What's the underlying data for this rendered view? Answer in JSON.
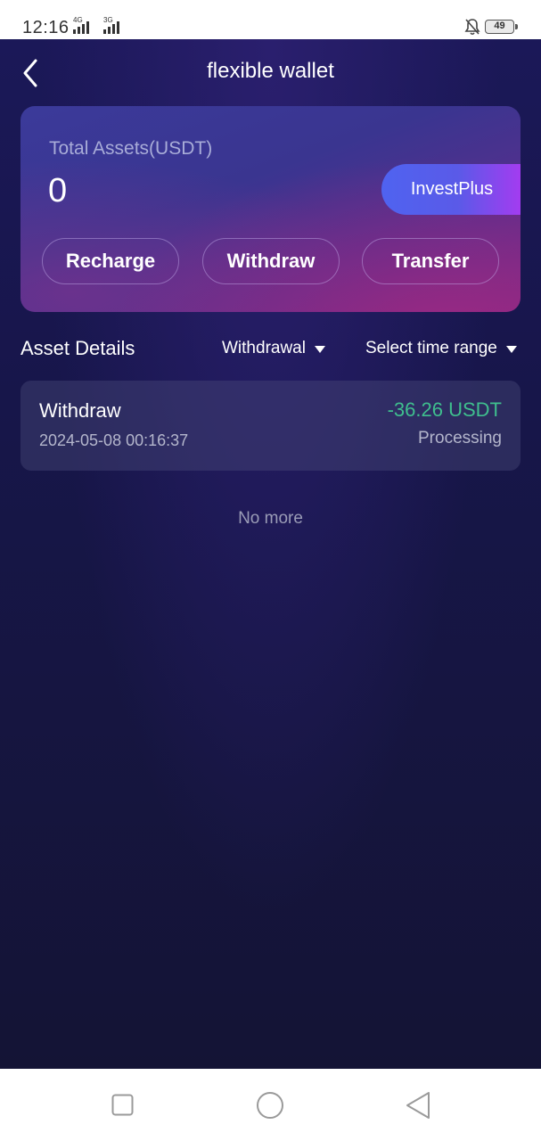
{
  "status_bar": {
    "time": "12:16",
    "network_1": "4G",
    "network_2": "3G",
    "battery": "49"
  },
  "header": {
    "title": "flexible wallet",
    "back_icon": "chevron-left-icon"
  },
  "assets_card": {
    "label": "Total Assets(USDT)",
    "value": "0",
    "investplus_label": "InvestPlus",
    "actions": [
      {
        "label": "Recharge"
      },
      {
        "label": "Withdraw"
      },
      {
        "label": "Transfer"
      }
    ]
  },
  "details": {
    "title": "Asset Details",
    "type_filter": "Withdrawal",
    "time_filter": "Select time range"
  },
  "records": [
    {
      "type": "Withdraw",
      "date": "2024-05-08 00:16:37",
      "amount": "-36.26 USDT",
      "status": "Processing"
    }
  ],
  "list_end": "No more",
  "colors": {
    "background": "#17164a",
    "amount_negative": "#3fbf8e",
    "accent_gradient_start": "#4f63f0",
    "accent_gradient_end": "#a33cf0"
  },
  "system_nav": {
    "recent_icon": "square-icon",
    "home_icon": "circle-icon",
    "back_icon": "triangle-back-icon"
  }
}
